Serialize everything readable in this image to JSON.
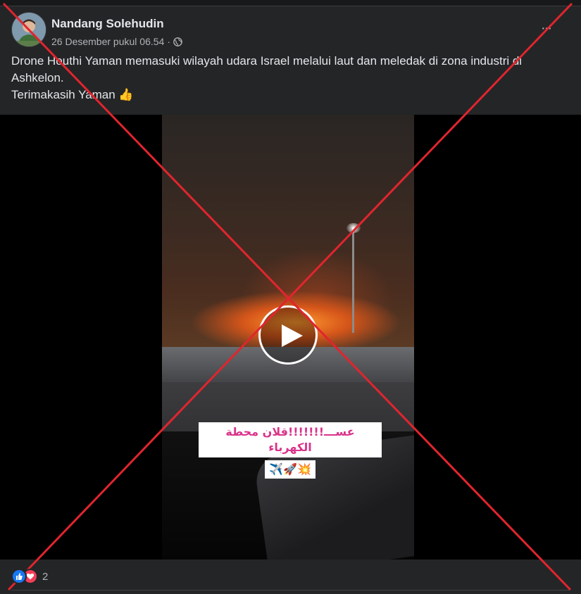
{
  "post": {
    "author": "Nandang Solehudin",
    "timestamp": "26 Desember pukul 06.54",
    "separator": "·",
    "privacy_icon": "globe-icon",
    "more_icon": "more-dots-icon",
    "more_label": "···",
    "caption_line1": "Drone Houthi Yaman memasuki wilayah udara Israel melalui laut dan meledak di zona industri di Ashkelon.",
    "caption_line2": "Terimakasih Yaman 👍"
  },
  "video": {
    "overlay_text": "عســـ!!!!!!!قلان محطة الكهرباء",
    "overlay_emoji": "✈️🚀💥",
    "play_icon": "play-icon"
  },
  "reactions": {
    "icons": [
      "like-icon",
      "love-icon"
    ],
    "count": "2"
  },
  "colors": {
    "background": "#18191a",
    "card": "#242526",
    "text": "#e4e6eb",
    "secondary_text": "#b0b3b8",
    "x_mark": "#e0252e",
    "like": "#1877f2",
    "love": "#f33e58",
    "overlay_text": "#d9338a"
  }
}
